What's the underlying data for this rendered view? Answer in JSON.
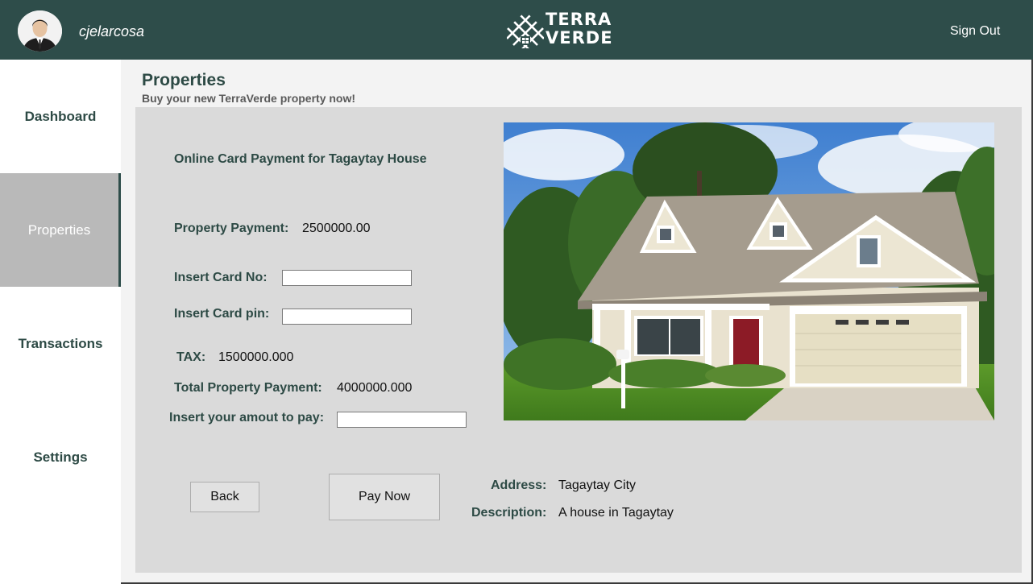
{
  "header": {
    "username": "cjelarcosa",
    "logo_line1": "TERRA",
    "logo_line2": "VERDE",
    "signout_label": "Sign Out"
  },
  "sidebar": {
    "items": [
      {
        "label": "Dashboard"
      },
      {
        "label": "Properties"
      },
      {
        "label": "Transactions"
      },
      {
        "label": "Settings"
      }
    ]
  },
  "page": {
    "title": "Properties",
    "subtitle": "Buy your new TerraVerde property now!"
  },
  "payment": {
    "heading": "Online Card Payment for Tagaytay House",
    "property_payment_label": "Property Payment:",
    "property_payment_value": "2500000.00",
    "card_no_label": "Insert Card No:",
    "card_no_value": "",
    "card_pin_label": "Insert Card pin:",
    "card_pin_value": "",
    "tax_label": "TAX:",
    "tax_value": "1500000.000",
    "total_label": "Total Property Payment:",
    "total_value": "4000000.000",
    "amount_label": "Insert your amout to pay:",
    "amount_value": ""
  },
  "buttons": {
    "back_label": "Back",
    "pay_label": "Pay Now"
  },
  "details": {
    "address_label": "Address:",
    "address_value": "Tagaytay City",
    "description_label": "Description:",
    "description_value": "A house in Tagaytay"
  },
  "colors": {
    "header_bg": "#2e4d4a",
    "label_text": "#2d4a45",
    "active_nav_bg": "#b9b9b9",
    "panel_bg": "#dadada"
  },
  "icons": {
    "logo": "terraverde-house-logo",
    "avatar": "user-avatar-photo",
    "property_photo": "house-photo"
  }
}
